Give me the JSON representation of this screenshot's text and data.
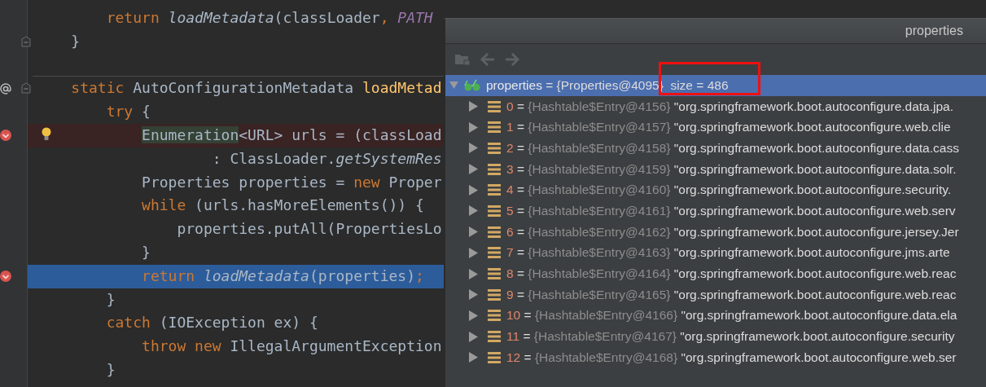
{
  "editor": {
    "lines": [
      {
        "kind": "normal",
        "tokens": [
          {
            "kind": "keyword",
            "t": "        return "
          },
          {
            "kind": "call",
            "t": "loadMetadata"
          },
          {
            "kind": "plain",
            "t": "(classLoader"
          },
          {
            "kind": "keyword",
            "t": ", "
          },
          {
            "kind": "constant",
            "t": "PATH"
          }
        ]
      },
      {
        "kind": "normal",
        "fold": true,
        "tokens": [
          {
            "kind": "plain",
            "t": "    }"
          }
        ]
      },
      {
        "kind": "normal",
        "separator": true,
        "override": true,
        "fold": true,
        "tokens": [
          {
            "kind": "keyword",
            "t": "    static"
          },
          {
            "kind": "plain",
            "t": " AutoConfigurationMetadata "
          },
          {
            "kind": "declaration",
            "t": "loadMetad"
          }
        ]
      },
      {
        "kind": "normal",
        "tokens": [
          {
            "kind": "keyword",
            "t": "        try"
          },
          {
            "kind": "plain",
            "t": " {"
          }
        ]
      },
      {
        "kind": "breakpoint",
        "breakpoint": true,
        "bulb": true,
        "tokens": [
          {
            "kind": "usage",
            "t": "            Enumeration"
          },
          {
            "kind": "plain",
            "t": "<URL> urls = (classLoad"
          }
        ]
      },
      {
        "kind": "normal",
        "tokens": [
          {
            "kind": "plain",
            "t": "                    : ClassLoader."
          },
          {
            "kind": "call",
            "t": "getSystemRes"
          }
        ]
      },
      {
        "kind": "normal",
        "tokens": [
          {
            "kind": "plain",
            "t": "            Properties properties = "
          },
          {
            "kind": "keyword",
            "t": "new"
          },
          {
            "kind": "plain",
            "t": " Proper"
          }
        ]
      },
      {
        "kind": "normal",
        "tokens": [
          {
            "kind": "keyword",
            "t": "            while"
          },
          {
            "kind": "plain",
            "t": " (urls.hasMoreElements()) {"
          }
        ]
      },
      {
        "kind": "normal",
        "tokens": [
          {
            "kind": "plain",
            "t": "                properties.putAll(PropertiesLo"
          }
        ]
      },
      {
        "kind": "normal",
        "tokens": [
          {
            "kind": "plain",
            "t": "            }"
          }
        ]
      },
      {
        "kind": "execution",
        "breakpoint": true,
        "tokens": [
          {
            "kind": "keyword",
            "t": "            return "
          },
          {
            "kind": "call",
            "t": "loadMetadata"
          },
          {
            "kind": "plain",
            "t": "(properties)"
          },
          {
            "kind": "keyword",
            "t": ";"
          }
        ]
      },
      {
        "kind": "normal",
        "tokens": [
          {
            "kind": "plain",
            "t": "        }"
          }
        ]
      },
      {
        "kind": "normal",
        "tokens": [
          {
            "kind": "keyword",
            "t": "        catch"
          },
          {
            "kind": "plain",
            "t": " (IOException ex) {"
          }
        ]
      },
      {
        "kind": "normal",
        "tokens": [
          {
            "kind": "keyword",
            "t": "            throw new"
          },
          {
            "kind": "plain",
            "t": " IllegalArgumentException"
          }
        ]
      },
      {
        "kind": "normal",
        "tokens": [
          {
            "kind": "plain",
            "t": "        }"
          }
        ]
      }
    ]
  },
  "popup": {
    "title": "properties",
    "toolbar": [
      {
        "kind": "folder",
        "disabled": true
      },
      {
        "kind": "back",
        "disabled": true
      },
      {
        "kind": "forward",
        "disabled": true
      }
    ],
    "annotation_box": true,
    "root": {
      "name": "properties",
      "sep": "=",
      "ref": "{Properties@4095}",
      "extra": "size = 486",
      "expanded": true,
      "selected": true
    },
    "rows": [
      {
        "name": "0",
        "sep": "=",
        "ref": "{Hashtable$Entry@4156}",
        "value": "\"org.springframework.boot.autoconfigure.data.jpa.",
        "expanded": false,
        "selected": false
      },
      {
        "name": "1",
        "sep": "=",
        "ref": "{Hashtable$Entry@4157}",
        "value": "\"org.springframework.boot.autoconfigure.web.clie",
        "expanded": false,
        "selected": false
      },
      {
        "name": "2",
        "sep": "=",
        "ref": "{Hashtable$Entry@4158}",
        "value": "\"org.springframework.boot.autoconfigure.data.cass",
        "expanded": false,
        "selected": false
      },
      {
        "name": "3",
        "sep": "=",
        "ref": "{Hashtable$Entry@4159}",
        "value": "\"org.springframework.boot.autoconfigure.data.solr.",
        "expanded": false,
        "selected": false
      },
      {
        "name": "4",
        "sep": "=",
        "ref": "{Hashtable$Entry@4160}",
        "value": "\"org.springframework.boot.autoconfigure.security.",
        "expanded": false,
        "selected": false
      },
      {
        "name": "5",
        "sep": "=",
        "ref": "{Hashtable$Entry@4161}",
        "value": "\"org.springframework.boot.autoconfigure.web.serv",
        "expanded": false,
        "selected": false
      },
      {
        "name": "6",
        "sep": "=",
        "ref": "{Hashtable$Entry@4162}",
        "value": "\"org.springframework.boot.autoconfigure.jersey.Jer",
        "expanded": false,
        "selected": false
      },
      {
        "name": "7",
        "sep": "=",
        "ref": "{Hashtable$Entry@4163}",
        "value": "\"org.springframework.boot.autoconfigure.jms.arte",
        "expanded": false,
        "selected": false
      },
      {
        "name": "8",
        "sep": "=",
        "ref": "{Hashtable$Entry@4164}",
        "value": "\"org.springframework.boot.autoconfigure.web.reac",
        "expanded": false,
        "selected": false
      },
      {
        "name": "9",
        "sep": "=",
        "ref": "{Hashtable$Entry@4165}",
        "value": "\"org.springframework.boot.autoconfigure.web.reac",
        "expanded": false,
        "selected": false
      },
      {
        "name": "10",
        "sep": "=",
        "ref": "{Hashtable$Entry@4166}",
        "value": "\"org.springframework.boot.autoconfigure.data.ela",
        "expanded": false,
        "selected": false
      },
      {
        "name": "11",
        "sep": "=",
        "ref": "{Hashtable$Entry@4167}",
        "value": "\"org.springframework.boot.autoconfigure.security",
        "expanded": false,
        "selected": false
      },
      {
        "name": "12",
        "sep": "=",
        "ref": "{Hashtable$Entry@4168}",
        "value": "\"org.springframework.boot.autoconfigure.web.ser",
        "expanded": false,
        "selected": false
      }
    ]
  }
}
